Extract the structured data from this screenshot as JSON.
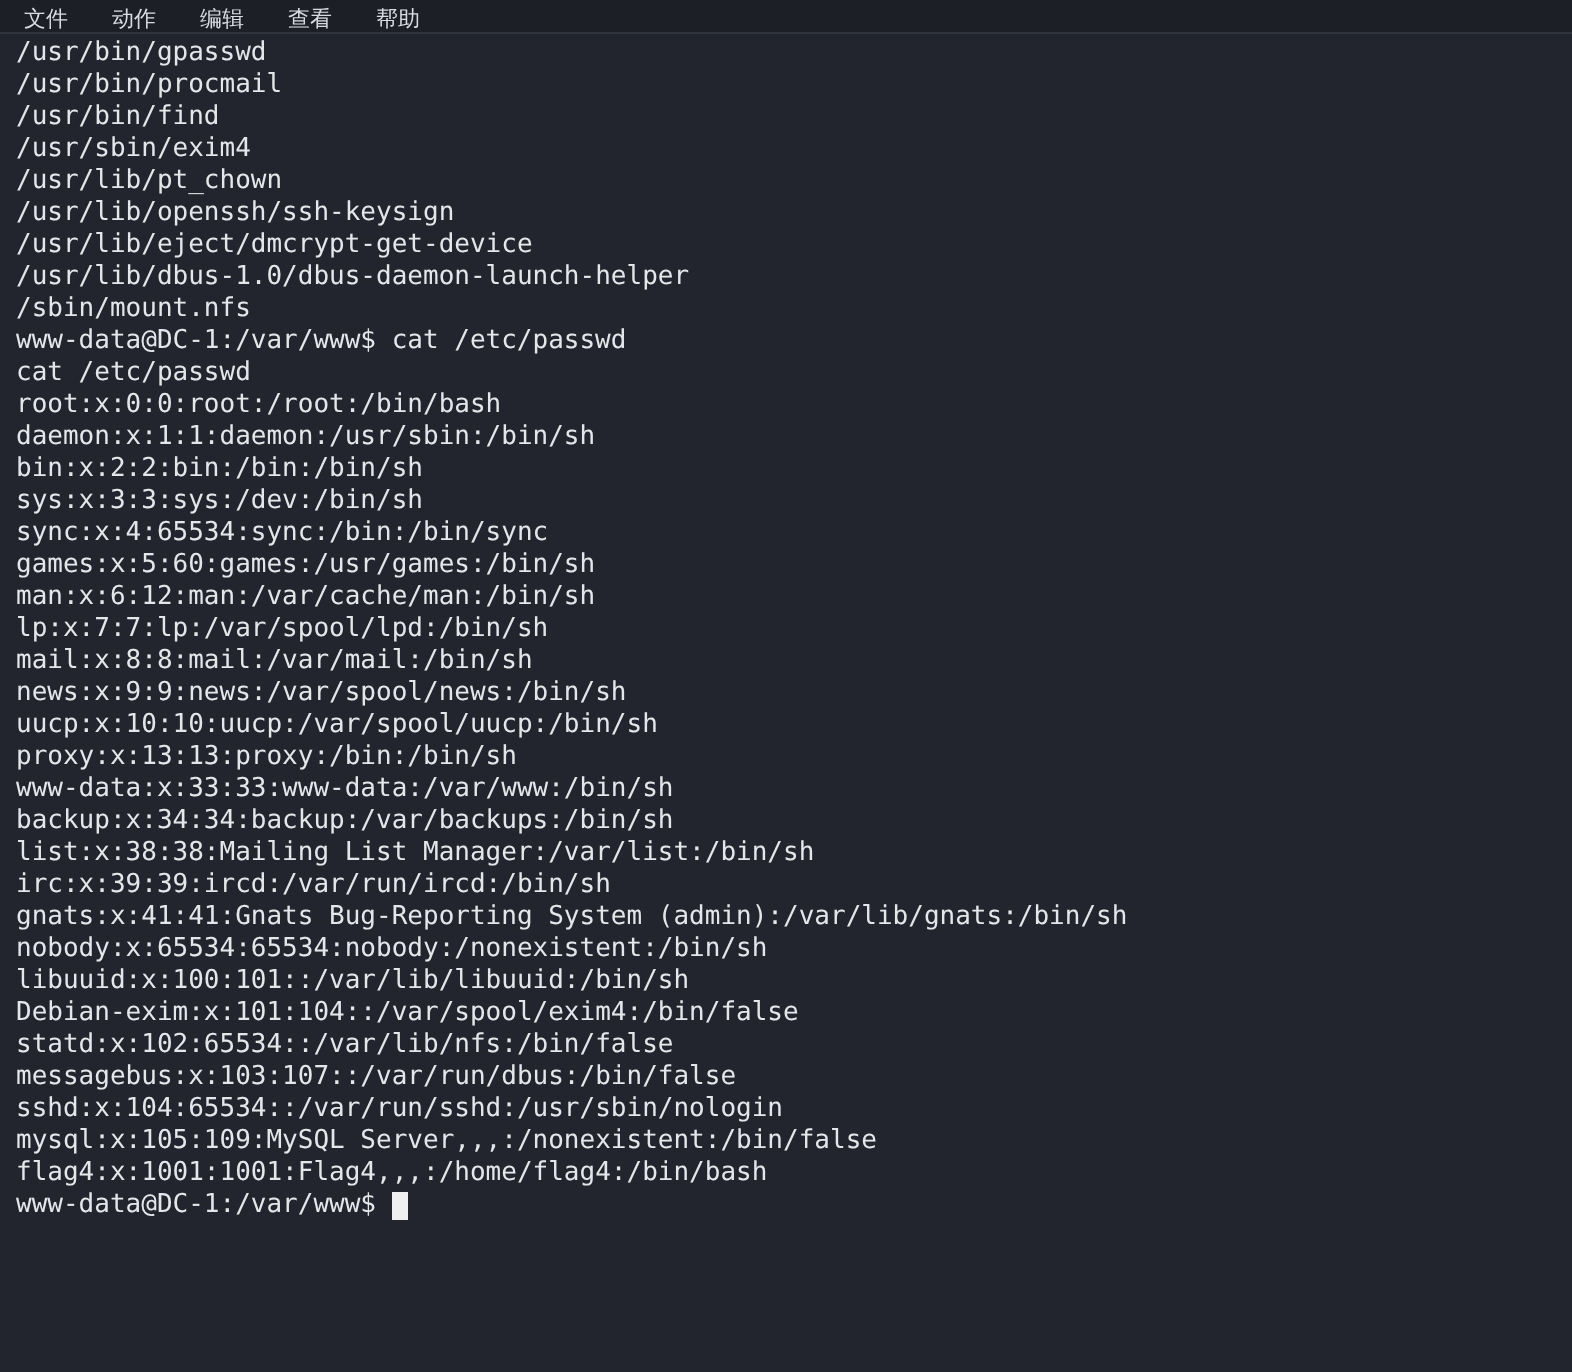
{
  "menu": [
    "文件",
    "动作",
    "编辑",
    "查看",
    "帮助"
  ],
  "lines": [
    {
      "kind": "output",
      "text": "/usr/bin/gpasswd"
    },
    {
      "kind": "output",
      "text": "/usr/bin/procmail"
    },
    {
      "kind": "output",
      "text": "/usr/bin/find"
    },
    {
      "kind": "output",
      "text": "/usr/sbin/exim4"
    },
    {
      "kind": "output",
      "text": "/usr/lib/pt_chown"
    },
    {
      "kind": "output",
      "text": "/usr/lib/openssh/ssh-keysign"
    },
    {
      "kind": "output",
      "text": "/usr/lib/eject/dmcrypt-get-device"
    },
    {
      "kind": "output",
      "text": "/usr/lib/dbus-1.0/dbus-daemon-launch-helper"
    },
    {
      "kind": "output",
      "text": "/sbin/mount.nfs"
    },
    {
      "kind": "prompt",
      "prompt": "www-data@DC-1:/var/www$",
      "text": "cat /etc/passwd"
    },
    {
      "kind": "output",
      "text": "cat /etc/passwd"
    },
    {
      "kind": "output",
      "text": "root:x:0:0:root:/root:/bin/bash"
    },
    {
      "kind": "output",
      "text": "daemon:x:1:1:daemon:/usr/sbin:/bin/sh"
    },
    {
      "kind": "output",
      "text": "bin:x:2:2:bin:/bin:/bin/sh"
    },
    {
      "kind": "output",
      "text": "sys:x:3:3:sys:/dev:/bin/sh"
    },
    {
      "kind": "output",
      "text": "sync:x:4:65534:sync:/bin:/bin/sync"
    },
    {
      "kind": "output",
      "text": "games:x:5:60:games:/usr/games:/bin/sh"
    },
    {
      "kind": "output",
      "text": "man:x:6:12:man:/var/cache/man:/bin/sh"
    },
    {
      "kind": "output",
      "text": "lp:x:7:7:lp:/var/spool/lpd:/bin/sh"
    },
    {
      "kind": "output",
      "text": "mail:x:8:8:mail:/var/mail:/bin/sh"
    },
    {
      "kind": "output",
      "text": "news:x:9:9:news:/var/spool/news:/bin/sh"
    },
    {
      "kind": "output",
      "text": "uucp:x:10:10:uucp:/var/spool/uucp:/bin/sh"
    },
    {
      "kind": "output",
      "text": "proxy:x:13:13:proxy:/bin:/bin/sh"
    },
    {
      "kind": "output",
      "text": "www-data:x:33:33:www-data:/var/www:/bin/sh"
    },
    {
      "kind": "output",
      "text": "backup:x:34:34:backup:/var/backups:/bin/sh"
    },
    {
      "kind": "output",
      "text": "list:x:38:38:Mailing List Manager:/var/list:/bin/sh"
    },
    {
      "kind": "output",
      "text": "irc:x:39:39:ircd:/var/run/ircd:/bin/sh"
    },
    {
      "kind": "output",
      "text": "gnats:x:41:41:Gnats Bug-Reporting System (admin):/var/lib/gnats:/bin/sh"
    },
    {
      "kind": "output",
      "text": "nobody:x:65534:65534:nobody:/nonexistent:/bin/sh"
    },
    {
      "kind": "output",
      "text": "libuuid:x:100:101::/var/lib/libuuid:/bin/sh"
    },
    {
      "kind": "output",
      "text": "Debian-exim:x:101:104::/var/spool/exim4:/bin/false"
    },
    {
      "kind": "output",
      "text": "statd:x:102:65534::/var/lib/nfs:/bin/false"
    },
    {
      "kind": "output",
      "text": "messagebus:x:103:107::/var/run/dbus:/bin/false"
    },
    {
      "kind": "output",
      "text": "sshd:x:104:65534::/var/run/sshd:/usr/sbin/nologin"
    },
    {
      "kind": "output",
      "text": "mysql:x:105:109:MySQL Server,,,:/nonexistent:/bin/false"
    },
    {
      "kind": "output",
      "text": "flag4:x:1001:1001:Flag4,,,:/home/flag4:/bin/bash"
    },
    {
      "kind": "cursor",
      "prompt": "www-data@DC-1:/var/www$"
    }
  ]
}
